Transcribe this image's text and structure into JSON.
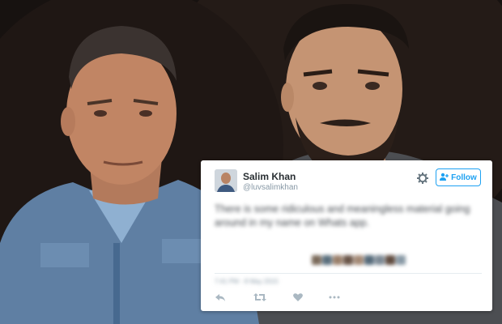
{
  "tweet": {
    "display_name": "Salim Khan",
    "handle": "@luvsalimkhan",
    "follow_label": "Follow",
    "text": "There is some ridiculous and meaningless material going around in my name on Whats app.",
    "date": "7:41 PM - 8 May 2015"
  },
  "icons": [
    "gear-icon",
    "add-user-icon",
    "reply-icon",
    "retweet-icon",
    "like-icon",
    "more-icon"
  ],
  "colors": {
    "accent": "#1da1f2",
    "name": "#292f33",
    "muted": "#8899a6"
  }
}
